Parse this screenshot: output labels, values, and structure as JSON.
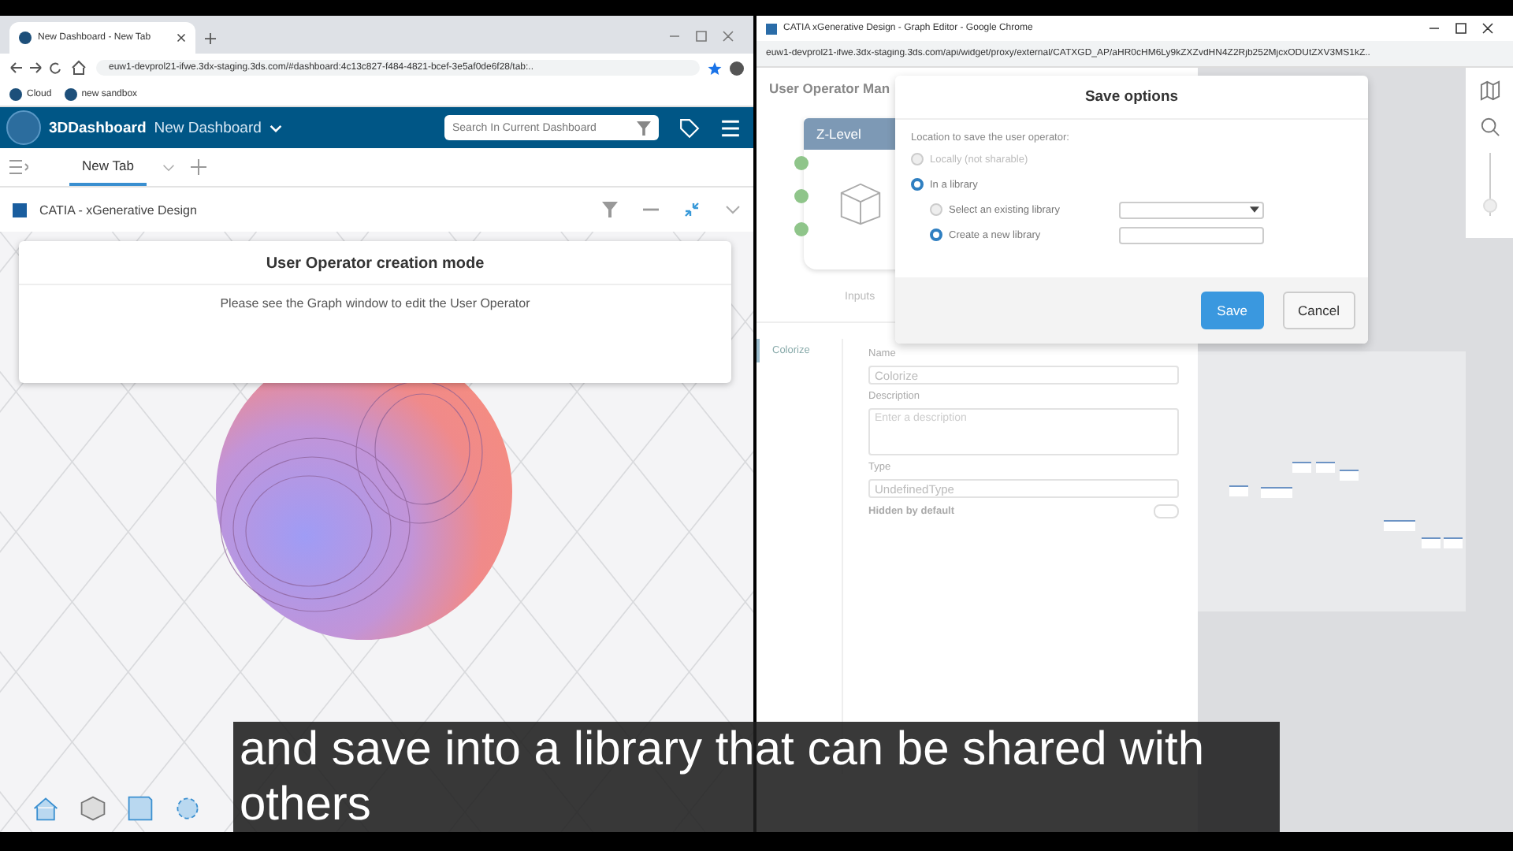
{
  "left_window": {
    "tab_title": "New Dashboard - New Tab",
    "url": "euw1-devprol21-ifwe.3dx-staging.3ds.com/#dashboard:4c13c827-f484-4821-bcef-3e5af0de6f28/tab:..",
    "bookmarks": [
      "Cloud",
      "new sandbox"
    ],
    "header": {
      "brand": "3DDashboard",
      "dashboard": "New Dashboard",
      "search_placeholder": "Search In Current Dashboard"
    },
    "tabs": [
      {
        "label": "New Tab",
        "selected": true
      }
    ],
    "widget_title": "CATIA - xGenerative Design",
    "notice": {
      "title": "User Operator creation mode",
      "message": "Please see the Graph window to edit the User Operator"
    }
  },
  "right_window": {
    "title": "CATIA xGenerative Design - Graph Editor - Google Chrome",
    "url": "euw1-devprol21-ifwe.3dx-staging.3ds.com/api/widget/proxy/external/CATXGD_AP/aHR0cHM6Ly9kZXZvdHN4Z2Rjb252MjcxODUtZXV3MS1kZ..",
    "zoom": {
      "level": 0.05
    },
    "panel_title": "User Operator Man",
    "node_title": "Z-Level",
    "inputs_label": "Inputs",
    "side_item": "Colorize",
    "form": {
      "name_label": "Name",
      "name_value": "Colorize",
      "description_label": "Description",
      "description_placeholder": "Enter a description",
      "type_label": "Type",
      "type_value": "UndefinedType",
      "hidden_label": "Hidden by default",
      "hidden_on": false
    }
  },
  "dialog": {
    "title": "Save options",
    "prompt": "Location to save the user operator:",
    "options": [
      {
        "label": "Locally (not sharable)",
        "selected": false
      },
      {
        "label": "In a library",
        "selected": true,
        "children": [
          {
            "label": "Select an existing library",
            "selected": false,
            "kind": "select"
          },
          {
            "label": "Create a new library",
            "selected": true,
            "kind": "text"
          }
        ]
      }
    ],
    "buttons": [
      {
        "label": "Save",
        "kind": "primary"
      },
      {
        "label": "Cancel",
        "kind": "secondary"
      }
    ]
  },
  "caption": "and save into a library that can be shared with others"
}
